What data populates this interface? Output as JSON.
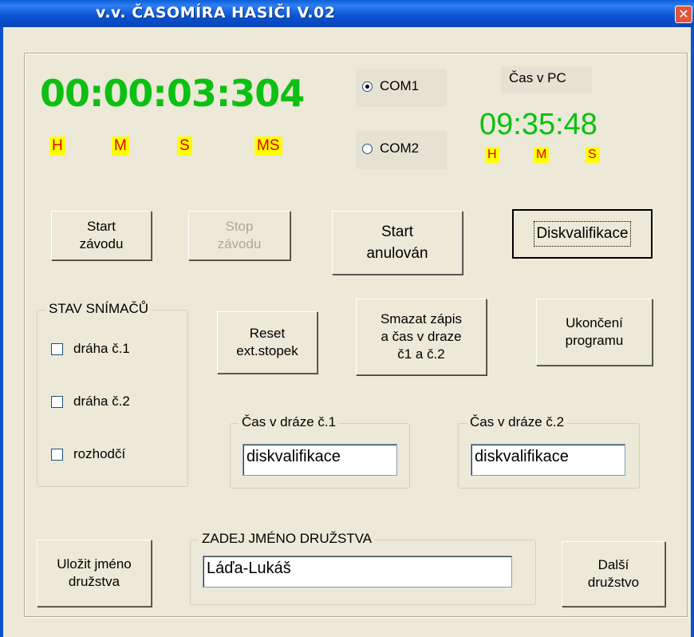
{
  "window": {
    "title": "v.v. ČASOMÍRA HASIČI V.02",
    "close_glyph": "✕"
  },
  "timer": {
    "display": "00:00:03:304",
    "units": [
      "H",
      "M",
      "S",
      "MS"
    ]
  },
  "com_ports": [
    {
      "label": "COM1",
      "selected": true
    },
    {
      "label": "COM2",
      "selected": false
    }
  ],
  "pc_time": {
    "label": "Čas v PC",
    "display": "09:35:48",
    "units": [
      "H",
      "M",
      "S"
    ]
  },
  "buttons": {
    "start_race": "Start\nzávodu",
    "stop_race": "Stop\nzávodu",
    "start_cancelled": "Start\nanulován",
    "disqualification": "Diskvalifikace",
    "reset_stopwatch": "Reset\next.stopek",
    "clear_record": "Smazat zápis\na čas v draze\nč1 a č.2",
    "exit_program": "Ukončení\nprogramu",
    "save_team": "Uložit jméno\ndružstva",
    "next_team": "Další\ndružstvo"
  },
  "sensor_status": {
    "legend": "STAV SNÍMAČŮ",
    "items": [
      "dráha č.1",
      "dráha č.2",
      "rozhodčí"
    ]
  },
  "lane1": {
    "legend": "Čas v dráze č.1",
    "value": "diskvalifikace"
  },
  "lane2": {
    "legend": "Čas v dráze č.2",
    "value": "diskvalifikace"
  },
  "team_name": {
    "legend": "ZADEJ JMÉNO DRUŽSTVA",
    "value": "Láďa-Lukáš"
  },
  "colors": {
    "timer_green": "#0dbf12",
    "unit_bg": "#ffff00",
    "unit_fg": "#e00000",
    "titlebar": "#0a52d0"
  }
}
